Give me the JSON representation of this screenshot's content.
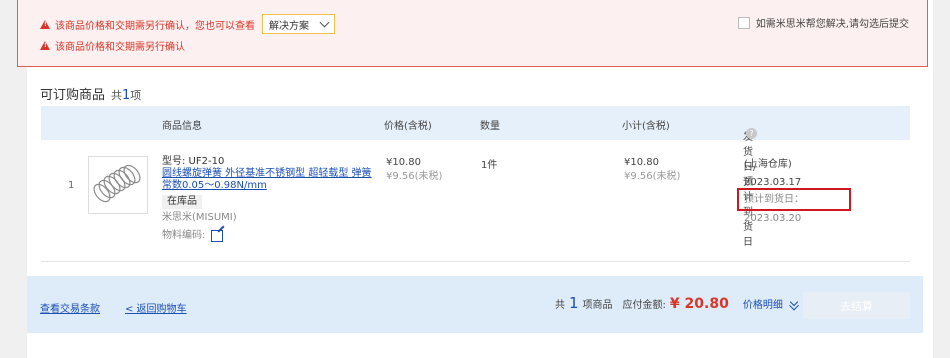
{
  "warning": {
    "line1": "该商品价格和交期需另行确认，您也可以查看",
    "solution_label": "解决方案",
    "line2": "该商品价格和交期需另行确认",
    "agree_label": "如需米思米帮您解决,请勾选后提交"
  },
  "section": {
    "title": "可订购商品",
    "count_prefix": "共",
    "count": "1",
    "count_suffix": "项"
  },
  "table": {
    "headers": {
      "product": "商品信息",
      "price": "价格(含税)",
      "qty": "数量",
      "subtotal": "小计(含税)",
      "ship": "发货日/预计到货日",
      "help_glyph": "?"
    },
    "rows": [
      {
        "index": "1",
        "model": "型号: UF2-10",
        "name": "圆线螺旋弹簧 外径基准不锈钢型 超轻载型 弹簧常数0.05～0.98N/mm",
        "stock": "在库品",
        "brand": "米思米(MISUMI)",
        "material_code": "物料编码:",
        "price_tax": "¥10.80",
        "price_notax": "¥9.56(未税)",
        "qty": "1件",
        "subtotal_tax": "¥10.80",
        "subtotal_notax": "¥9.56(未税)",
        "warehouse": "(上海仓库)",
        "ship_date": "2023.03.17",
        "eta": "预计到货日：2023.03.20"
      }
    ]
  },
  "footer": {
    "terms_link": "查看交易条款",
    "back_link": "< 返回购物车",
    "total_prefix": "共",
    "total_count": "1",
    "total_suffix": "项商品",
    "amount_label": "应付金额:",
    "amount": "¥ 20.80",
    "detail_label": "价格明细",
    "checkout_label": "去结算"
  },
  "colors": {
    "accent_blue": "#1a4fb5",
    "warning_red": "#d9362a",
    "header_bg": "#e6f0fb",
    "footer_bg": "#deebf8",
    "highlight_border": "#d0191f"
  }
}
